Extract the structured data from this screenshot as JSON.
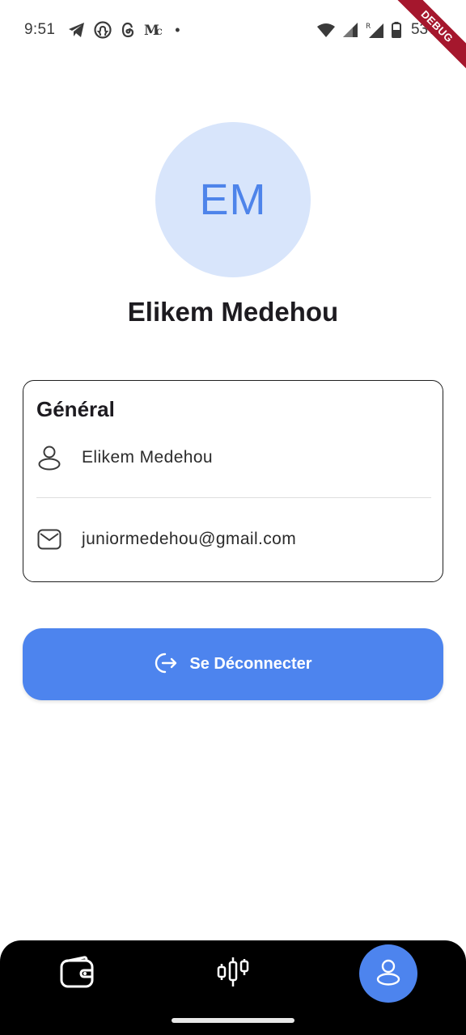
{
  "status_bar": {
    "time": "9:51",
    "battery": "53%",
    "notification_icons": [
      "telegram-icon",
      "github-icon",
      "threads-icon",
      "medium-icon"
    ],
    "debug_banner": "DEBUG"
  },
  "profile": {
    "initials": "EM",
    "name": "Elikem Medehou"
  },
  "general_card": {
    "title": "Général",
    "rows": [
      {
        "icon": "person-icon",
        "value": "Elikem Medehou"
      },
      {
        "icon": "mail-icon",
        "value": "juniormedehou@gmail.com"
      }
    ]
  },
  "logout": {
    "label": "Se Déconnecter",
    "icon": "logout-icon"
  },
  "bottom_nav": {
    "items": [
      {
        "icon": "wallet-icon",
        "active": false
      },
      {
        "icon": "candlestick-chart-icon",
        "active": false
      },
      {
        "icon": "profile-icon",
        "active": true
      }
    ]
  },
  "colors": {
    "accent": "#4d84ee",
    "avatar_bg": "#d8e5fb",
    "avatar_text": "#4e84ea",
    "nav_bg": "#000000"
  }
}
